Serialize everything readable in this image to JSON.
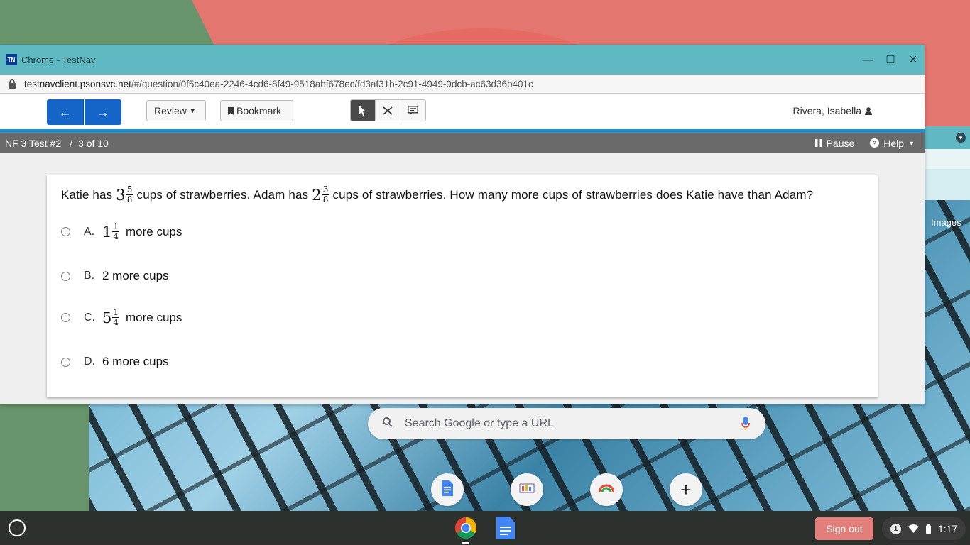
{
  "window": {
    "title": "Chrome - TestNav",
    "logo_text": "TN",
    "controls": {
      "minimize": "—",
      "maximize": "☐",
      "close": "✕"
    }
  },
  "address": {
    "host": "testnavclient.psonsvc.net",
    "path": "/#/question/0f5c40ea-2246-4cd6-8f49-9518abf678ec/fd3af31b-2c91-4949-9dcb-ac63d36b401c"
  },
  "toolbar": {
    "prev_symbol": "←",
    "next_symbol": "→",
    "review_label": "Review",
    "bookmark_label": "Bookmark",
    "user_name": "Rivera, Isabella"
  },
  "testbar": {
    "test_name": "NF 3 Test #2",
    "separator": "/",
    "progress": "3 of 10",
    "pause_label": "Pause",
    "help_label": "Help"
  },
  "question": {
    "part1": "Katie has",
    "katie_whole": "3",
    "katie_num": "5",
    "katie_den": "8",
    "part2": "cups of strawberries. Adam has",
    "adam_whole": "2",
    "adam_num": "3",
    "adam_den": "8",
    "part3": "cups of strawberries. How many more cups of strawberries does Katie have than Adam?"
  },
  "options": {
    "a": {
      "letter": "A.",
      "whole": "1",
      "num": "1",
      "den": "4",
      "text": "more cups"
    },
    "b": {
      "letter": "B.",
      "text": "2 more cups"
    },
    "c": {
      "letter": "C.",
      "whole": "5",
      "num": "1",
      "den": "4",
      "text": "more cups"
    },
    "d": {
      "letter": "D.",
      "text": "6 more cups"
    }
  },
  "newtab": {
    "search_placeholder": "Search Google or type a URL",
    "images_label": "Images",
    "add_shortcut": "+"
  },
  "shelf": {
    "signout_label": "Sign out",
    "notification_count": "1",
    "time": "1:17"
  }
}
